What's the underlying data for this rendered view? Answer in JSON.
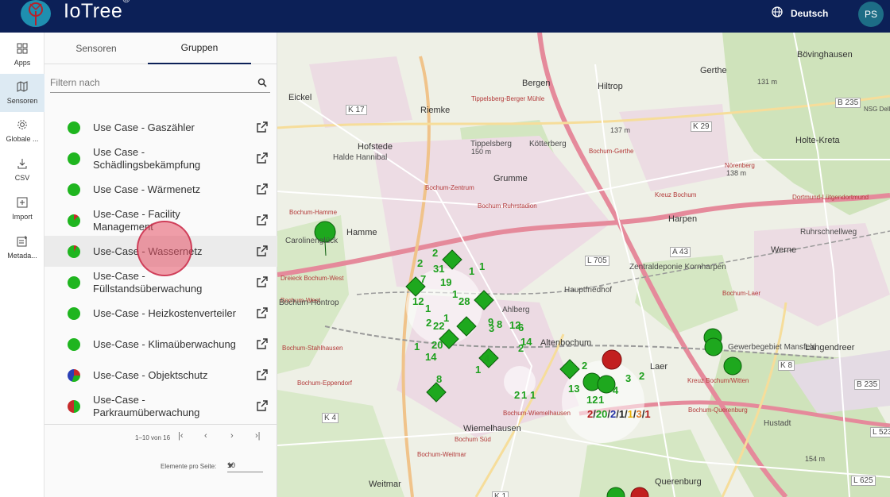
{
  "app": {
    "name": "IoTree",
    "registered": "®",
    "language": "Deutsch",
    "user_initials": "PS"
  },
  "rail": [
    {
      "label": "Apps",
      "icon": "apps-icon"
    },
    {
      "label": "Sensoren",
      "icon": "map-icon"
    },
    {
      "label": "Globale ...",
      "icon": "gear-icon"
    },
    {
      "label": "CSV",
      "icon": "download-icon"
    },
    {
      "label": "Import",
      "icon": "import-icon"
    },
    {
      "label": "Metada...",
      "icon": "metadata-icon"
    }
  ],
  "tabs": [
    {
      "label": "Sensoren"
    },
    {
      "label": "Gruppen"
    }
  ],
  "active_tab": "Gruppen",
  "filter": {
    "placeholder": "Filtern nach",
    "value": ""
  },
  "groups": [
    {
      "name": "Use Case - Gaszähler",
      "status": "green"
    },
    {
      "name": "Use Case - Schädlingsbekämpfung",
      "status": "green"
    },
    {
      "name": "Use Case - Wärmenetz",
      "status": "green"
    },
    {
      "name": "Use-Case - Facility Management",
      "status": "green-red"
    },
    {
      "name": "Use-Case - Wassernetz",
      "status": "green-red"
    },
    {
      "name": "Use-Case - Füllstandsüberwachung",
      "status": "green"
    },
    {
      "name": "Use-Case - Heizkostenverteiler",
      "status": "green"
    },
    {
      "name": "Use-Case - Klimaüberwachung",
      "status": "green"
    },
    {
      "name": "Use-Case - Objektschutz",
      "status": "multi"
    },
    {
      "name": "Use-Case - Parkraumüberwachung",
      "status": "green-red-half"
    }
  ],
  "pagination": {
    "range": "1–10 von 16",
    "per_page_label": "Elemente pro Seite:",
    "per_page": "10"
  },
  "map": {
    "places": [
      "Bövinghausen",
      "Gerthe",
      "Eickel",
      "Bergen",
      "Hiltrop",
      "Riemke",
      "Hofstede",
      "Grumme",
      "Tippelsberg",
      "Kötterberg",
      "Holte-Kreta",
      "Hamme",
      "Harpen",
      "Werne",
      "Altenbochum",
      "Laer",
      "Langendreer",
      "Wiemelhausen",
      "Weitmar",
      "Querenburg",
      "Tippelsberg-Berger Mühle",
      "Nörenberg",
      "Dortmund-Lütgendortmund",
      "Bochum-Gerthe",
      "Bochum-Hamme",
      "Bochum-Zentrum",
      "Bochum Ruhrstadion",
      "Kreuz Bochum",
      "Dreieck Bochum-West",
      "Bochum-West",
      "Bochum-Stahlhausen",
      "Bochum-Eppendorf",
      "Bochum-Laer",
      "Gewerbegebiet Mansfeld",
      "Kreuz Bochum/Witten",
      "Bochum-Wiemelhausen",
      "Bochum Süd",
      "Bochum-Weitmar",
      "Bochum-Querenburg",
      "Zentraldeponie Kornharpen",
      "Hauptfriedhof",
      "Carolinenglück",
      "Ruhrschnellweg",
      "Ahlberg",
      "Hustadt",
      "Bochum-Höntrop",
      "Halde Hannibal"
    ],
    "road_labels": [
      "K 17",
      "K 29",
      "B 235",
      "K 8",
      "K 4",
      "L 705",
      "A 43",
      "B 235",
      "L 523",
      "L 625",
      "K 1",
      "NSG Dellwiger Bach"
    ],
    "elevations": [
      "131 m",
      "137 m",
      "150 m",
      "138 m",
      "154 m"
    ],
    "cluster_numbers": [
      "2",
      "31",
      "7",
      "12",
      "19",
      "1",
      "1",
      "22",
      "28",
      "9",
      "8",
      "3",
      "12",
      "6",
      "14",
      "2",
      "20",
      "14",
      "2",
      "1",
      "1",
      "4",
      "3",
      "2",
      "2",
      "13",
      "12",
      "1",
      "4",
      "8",
      "2",
      "1",
      "1",
      "1",
      "1",
      "2",
      "1"
    ],
    "multi_label": {
      "a": "2",
      "b": "20",
      "c": "2",
      "d": "1",
      "e": "1",
      "f": "3",
      "g": "1"
    }
  }
}
